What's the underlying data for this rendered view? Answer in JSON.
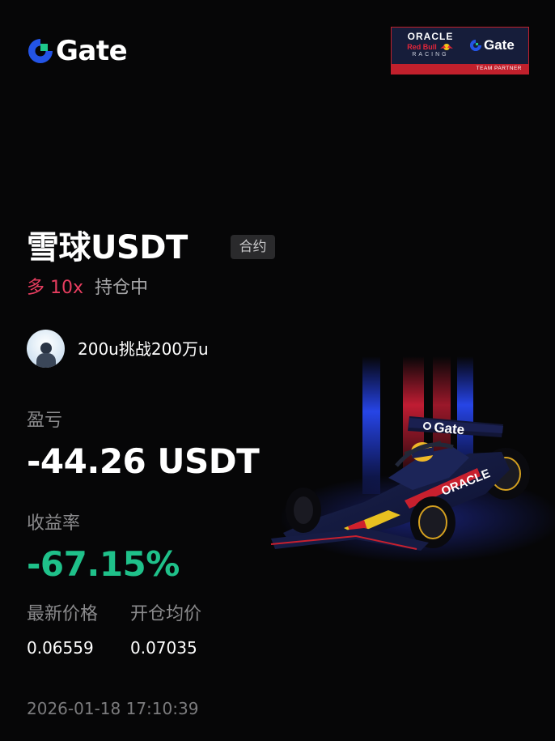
{
  "brand": {
    "logo_text": "Gate",
    "accent": "#2354e6",
    "accent_green": "#1ec98b"
  },
  "sponsor": {
    "line1": "ORACLE",
    "line2": "Red Bull",
    "line3": "RACING",
    "partner_logo": "Gate",
    "tagline": "TEAM PARTNER",
    "frame_color": "#c1202c",
    "bg_color": "#161d3a"
  },
  "position": {
    "symbol": "雪球USDT",
    "market_badge": "合约",
    "direction": "多 10x",
    "direction_color": "#e63d5f",
    "status": "持仓中"
  },
  "user": {
    "name": "200u挑战200万u",
    "avatar_icon": "user-avatar"
  },
  "stats": {
    "pnl_label": "盈亏",
    "pnl_value": "-44.26 USDT",
    "roe_label": "收益率",
    "roe_value": "-67.15%",
    "roe_color": "#1fc18a",
    "last_price_label": "最新价格",
    "last_price_value": "0.06559",
    "entry_price_label": "开仓均价",
    "entry_price_value": "0.07035"
  },
  "timestamp": "2026-01-18 17:10:39",
  "artwork": {
    "wing_text": "Gate",
    "sidepod_text": "ORACLE"
  }
}
